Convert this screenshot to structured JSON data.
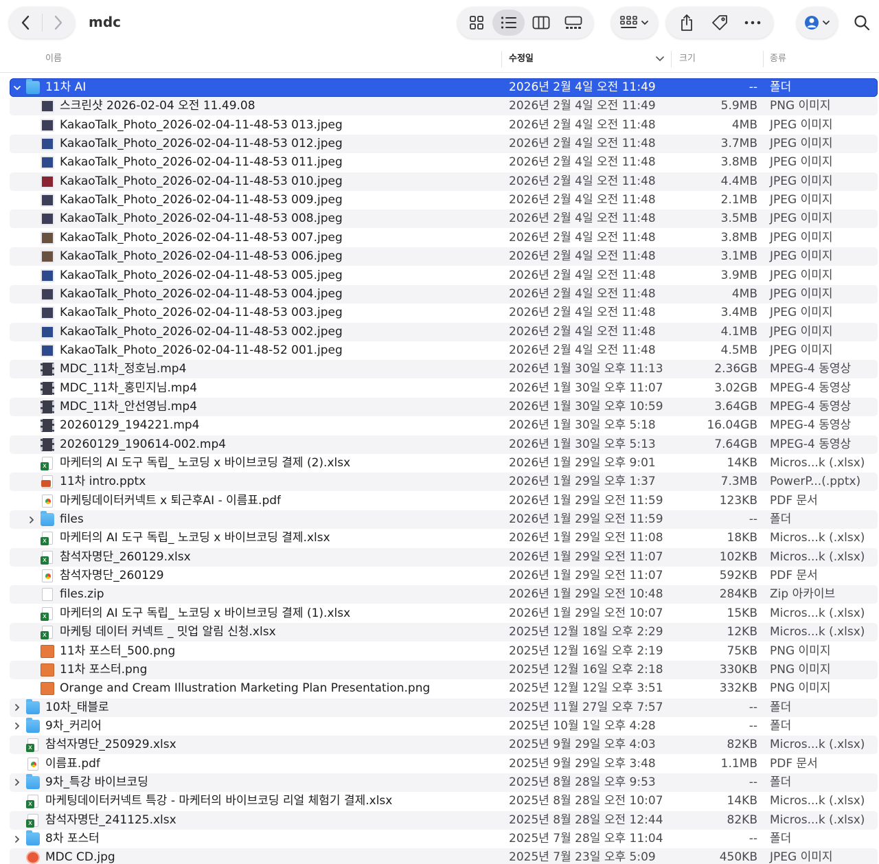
{
  "window": {
    "title": "mdc"
  },
  "toolbar": {
    "back_icon": "chevron-left-icon",
    "forward_icon": "chevron-right-icon",
    "views": [
      "icon-grid-icon",
      "list-view-icon",
      "column-view-icon",
      "gallery-view-icon"
    ],
    "active_view": "list-view-icon",
    "group_icon": "group-by-icon",
    "actions": [
      "share-icon",
      "tag-icon",
      "more-icon"
    ],
    "user_icon": "user-avatar-icon",
    "search_icon": "search-icon"
  },
  "columns": {
    "name": "이름",
    "date": "수정일",
    "size": "크기",
    "kind": "종류",
    "sorted": "date"
  },
  "colors": {
    "selection": "#2f5ee6",
    "folder": "#4aaaf0",
    "stripe": "#f4f4f6"
  },
  "rows": [
    {
      "name": "11차 AI",
      "date": "2026년 2월 4일 오전 11:49",
      "size": "--",
      "kind": "폴더",
      "icon": "folder",
      "level": 0,
      "expanded": true,
      "selected": true
    },
    {
      "name": "스크린샷 2026-02-04 오전 11.49.08",
      "date": "2026년 2월 4일 오전 11:49",
      "size": "5.9MB",
      "kind": "PNG 이미지",
      "icon": "img",
      "level": 1
    },
    {
      "name": "KakaoTalk_Photo_2026-02-04-11-48-53 013.jpeg",
      "date": "2026년 2월 4일 오전 11:48",
      "size": "4MB",
      "kind": "JPEG 이미지",
      "icon": "img",
      "level": 1
    },
    {
      "name": "KakaoTalk_Photo_2026-02-04-11-48-53 012.jpeg",
      "date": "2026년 2월 4일 오전 11:48",
      "size": "3.7MB",
      "kind": "JPEG 이미지",
      "icon": "img-blue",
      "level": 1
    },
    {
      "name": "KakaoTalk_Photo_2026-02-04-11-48-53 011.jpeg",
      "date": "2026년 2월 4일 오전 11:48",
      "size": "3.8MB",
      "kind": "JPEG 이미지",
      "icon": "img-blue",
      "level": 1
    },
    {
      "name": "KakaoTalk_Photo_2026-02-04-11-48-53 010.jpeg",
      "date": "2026년 2월 4일 오전 11:48",
      "size": "4.4MB",
      "kind": "JPEG 이미지",
      "icon": "img-red",
      "level": 1
    },
    {
      "name": "KakaoTalk_Photo_2026-02-04-11-48-53 009.jpeg",
      "date": "2026년 2월 4일 오전 11:48",
      "size": "2.1MB",
      "kind": "JPEG 이미지",
      "icon": "img",
      "level": 1
    },
    {
      "name": "KakaoTalk_Photo_2026-02-04-11-48-53 008.jpeg",
      "date": "2026년 2월 4일 오전 11:48",
      "size": "3.5MB",
      "kind": "JPEG 이미지",
      "icon": "img",
      "level": 1
    },
    {
      "name": "KakaoTalk_Photo_2026-02-04-11-48-53 007.jpeg",
      "date": "2026년 2월 4일 오전 11:48",
      "size": "3.8MB",
      "kind": "JPEG 이미지",
      "icon": "img-brown",
      "level": 1
    },
    {
      "name": "KakaoTalk_Photo_2026-02-04-11-48-53 006.jpeg",
      "date": "2026년 2월 4일 오전 11:48",
      "size": "3.1MB",
      "kind": "JPEG 이미지",
      "icon": "img-brown",
      "level": 1
    },
    {
      "name": "KakaoTalk_Photo_2026-02-04-11-48-53 005.jpeg",
      "date": "2026년 2월 4일 오전 11:48",
      "size": "3.9MB",
      "kind": "JPEG 이미지",
      "icon": "img-blue",
      "level": 1
    },
    {
      "name": "KakaoTalk_Photo_2026-02-04-11-48-53 004.jpeg",
      "date": "2026년 2월 4일 오전 11:48",
      "size": "4MB",
      "kind": "JPEG 이미지",
      "icon": "img",
      "level": 1
    },
    {
      "name": "KakaoTalk_Photo_2026-02-04-11-48-53 003.jpeg",
      "date": "2026년 2월 4일 오전 11:48",
      "size": "3.4MB",
      "kind": "JPEG 이미지",
      "icon": "img",
      "level": 1
    },
    {
      "name": "KakaoTalk_Photo_2026-02-04-11-48-53 002.jpeg",
      "date": "2026년 2월 4일 오전 11:48",
      "size": "4.1MB",
      "kind": "JPEG 이미지",
      "icon": "img-blue",
      "level": 1
    },
    {
      "name": "KakaoTalk_Photo_2026-02-04-11-48-52 001.jpeg",
      "date": "2026년 2월 4일 오전 11:48",
      "size": "4.5MB",
      "kind": "JPEG 이미지",
      "icon": "img-blue",
      "level": 1
    },
    {
      "name": "MDC_11차_정호님.mp4",
      "date": "2026년 1월 30일 오후 11:13",
      "size": "2.36GB",
      "kind": "MPEG-4 동영상",
      "icon": "video",
      "level": 1
    },
    {
      "name": "MDC_11차_홍민지님.mp4",
      "date": "2026년 1월 30일 오후 11:07",
      "size": "3.02GB",
      "kind": "MPEG-4 동영상",
      "icon": "video",
      "level": 1
    },
    {
      "name": "MDC_11차_안선영님.mp4",
      "date": "2026년 1월 30일 오후 10:59",
      "size": "3.64GB",
      "kind": "MPEG-4 동영상",
      "icon": "video",
      "level": 1
    },
    {
      "name": "20260129_194221.mp4",
      "date": "2026년 1월 30일 오후 5:18",
      "size": "16.04GB",
      "kind": "MPEG-4 동영상",
      "icon": "video",
      "level": 1
    },
    {
      "name": "20260129_190614-002.mp4",
      "date": "2026년 1월 30일 오후 5:13",
      "size": "7.64GB",
      "kind": "MPEG-4 동영상",
      "icon": "video",
      "level": 1
    },
    {
      "name": "마케터의 AI 도구 독립_ 노코딩 x 바이브코딩 결제 (2).xlsx",
      "date": "2026년 1월 29일 오후 9:01",
      "size": "14KB",
      "kind": "Micros...k (.xlsx)",
      "icon": "xlsx",
      "level": 1
    },
    {
      "name": "11차 intro.pptx",
      "date": "2026년 1월 29일 오후 1:37",
      "size": "7.3MB",
      "kind": "PowerP...(.pptx)",
      "icon": "pptx",
      "level": 1
    },
    {
      "name": "마케팅데이터커넥트 x 퇴근후AI - 이름표.pdf",
      "date": "2026년 1월 29일 오전 11:59",
      "size": "123KB",
      "kind": "PDF 문서",
      "icon": "pdf",
      "level": 1
    },
    {
      "name": "files",
      "date": "2026년 1월 29일 오전 11:59",
      "size": "--",
      "kind": "폴더",
      "icon": "folder",
      "level": 1,
      "expanded": false
    },
    {
      "name": "마케터의 AI 도구 독립_ 노코딩 x 바이브코딩 결제.xlsx",
      "date": "2026년 1월 29일 오전 11:08",
      "size": "18KB",
      "kind": "Micros...k (.xlsx)",
      "icon": "xlsx",
      "level": 1
    },
    {
      "name": "참석자명단_260129.xlsx",
      "date": "2026년 1월 29일 오전 11:07",
      "size": "102KB",
      "kind": "Micros...k (.xlsx)",
      "icon": "xlsx",
      "level": 1
    },
    {
      "name": "참석자명단_260129",
      "date": "2026년 1월 29일 오전 11:07",
      "size": "592KB",
      "kind": "PDF 문서",
      "icon": "pdf",
      "level": 1
    },
    {
      "name": "files.zip",
      "date": "2026년 1월 29일 오전 10:48",
      "size": "284KB",
      "kind": "Zip 아카이브",
      "icon": "zip",
      "level": 1
    },
    {
      "name": "마케터의 AI 도구 독립_ 노코딩 x 바이브코딩 결제 (1).xlsx",
      "date": "2026년 1월 29일 오전 10:07",
      "size": "15KB",
      "kind": "Micros...k (.xlsx)",
      "icon": "xlsx",
      "level": 1
    },
    {
      "name": "마케팅 데이터 커넥트 _ 밋업 알림 신청.xlsx",
      "date": "2025년 12월 18일 오후 2:29",
      "size": "12KB",
      "kind": "Micros...k (.xlsx)",
      "icon": "xlsx",
      "level": 1
    },
    {
      "name": "11차 포스터_500.png",
      "date": "2025년 12월 16일 오후 2:19",
      "size": "75KB",
      "kind": "PNG 이미지",
      "icon": "png",
      "level": 1
    },
    {
      "name": "11차 포스터.png",
      "date": "2025년 12월 16일 오후 2:18",
      "size": "330KB",
      "kind": "PNG 이미지",
      "icon": "png",
      "level": 1
    },
    {
      "name": "Orange and Cream Illustration Marketing Plan Presentation.png",
      "date": "2025년 12월 12일 오후 3:51",
      "size": "332KB",
      "kind": "PNG 이미지",
      "icon": "png",
      "level": 1
    },
    {
      "name": "10차_태블로",
      "date": "2025년 11월 27일 오후 7:57",
      "size": "--",
      "kind": "폴더",
      "icon": "folder",
      "level": 0,
      "expanded": false
    },
    {
      "name": "9차_커리어",
      "date": "2025년 10월 1일 오후 4:28",
      "size": "--",
      "kind": "폴더",
      "icon": "folder",
      "level": 0,
      "expanded": false
    },
    {
      "name": "참석자명단_250929.xlsx",
      "date": "2025년 9월 29일 오후 4:03",
      "size": "82KB",
      "kind": "Micros...k (.xlsx)",
      "icon": "xlsx",
      "level": 0
    },
    {
      "name": "이름표.pdf",
      "date": "2025년 9월 29일 오후 3:48",
      "size": "1.1MB",
      "kind": "PDF 문서",
      "icon": "pdf",
      "level": 0
    },
    {
      "name": "9차_특강 바이브코딩",
      "date": "2025년 8월 28일 오후 9:53",
      "size": "--",
      "kind": "폴더",
      "icon": "folder",
      "level": 0,
      "expanded": false
    },
    {
      "name": "마케팅데이터커넥트 특강 - 마케터의 바이브코딩 리얼 체험기 결제.xlsx",
      "date": "2025년 8월 28일 오전 10:07",
      "size": "14KB",
      "kind": "Micros...k (.xlsx)",
      "icon": "xlsx",
      "level": 0
    },
    {
      "name": "참석자명단_241125.xlsx",
      "date": "2025년 8월 28일 오전 12:44",
      "size": "82KB",
      "kind": "Micros...k (.xlsx)",
      "icon": "xlsx",
      "level": 0
    },
    {
      "name": "8차 포스터",
      "date": "2025년 7월 28일 오후 11:04",
      "size": "--",
      "kind": "폴더",
      "icon": "folder",
      "level": 0,
      "expanded": false
    },
    {
      "name": "MDC CD.jpg",
      "date": "2025년 7월 23일 오후 5:09",
      "size": "450KB",
      "kind": "JPEG 이미지",
      "icon": "jpg-orange",
      "level": 0
    }
  ]
}
